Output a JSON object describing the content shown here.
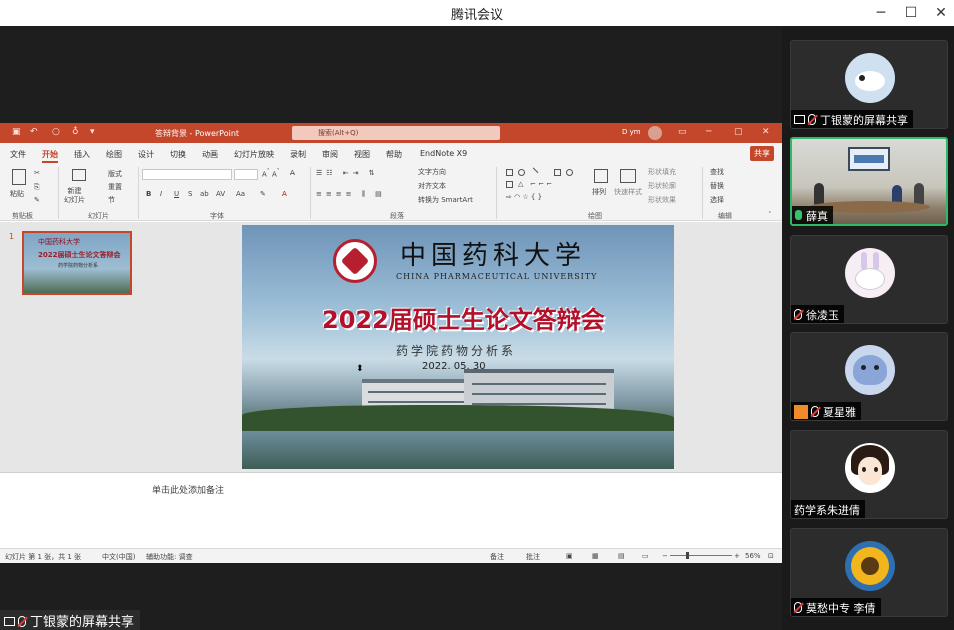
{
  "window": {
    "title": "腾讯会议",
    "minimize": "─",
    "maximize": "☐",
    "close": "✕"
  },
  "ppt": {
    "file_name": "答辩背景 - PowerPoint",
    "search_placeholder": "搜索(Alt+Q)",
    "user": "D ym",
    "tabs": [
      "文件",
      "开始",
      "插入",
      "绘图",
      "设计",
      "切换",
      "动画",
      "幻灯片放映",
      "录制",
      "审阅",
      "视图",
      "帮助",
      "EndNote X9"
    ],
    "active_tab": "开始",
    "share_button": "共享",
    "ribbon_groups": [
      "剪贴板",
      "幻灯片",
      "字体",
      "段落",
      "绘图",
      "编辑"
    ],
    "ribbon_tools": {
      "paste": "粘贴",
      "new_slide": "新建\n幻灯片",
      "layout": "版式",
      "reset": "重置",
      "section": "节",
      "text_direction": "文字方向",
      "align_text": "对齐文本",
      "smartart": "转换为 SmartArt",
      "arrange": "排列",
      "quick_styles": "快速样式",
      "shape_fill": "形状填充",
      "shape_outline": "形状轮廓",
      "shape_effects": "形状效果",
      "find": "查找",
      "replace": "替换",
      "select": "选择"
    },
    "thumbnail": {
      "number": "1",
      "line1": "中国药科大学",
      "line2": "2022届硕士生论文答辩会",
      "line3": "药学院药物分析系"
    },
    "slide": {
      "university_cn": "中国药科大学",
      "university_en": "CHINA PHARMACEUTICAL UNIVERSITY",
      "title": "2022届硕士生论文答辩会",
      "subtitle": "药学院药物分析系",
      "date": "2022. 05. 30"
    },
    "notes_placeholder": "单击此处添加备注",
    "status": {
      "slide_count": "幻灯片 第 1 张，共 1 张",
      "language": "中文(中国)",
      "accessibility": "辅助功能: 调查",
      "notes": "备注",
      "comments": "批注",
      "zoom": "56%"
    }
  },
  "share_label": "丁银蒙的屏幕共享",
  "participants": [
    {
      "name": "丁银蒙的屏幕共享",
      "avatar": "cat-icon",
      "screen": true,
      "active": false
    },
    {
      "name": "薛真",
      "avatar": "video",
      "screen": false,
      "active": true
    },
    {
      "name": "徐凌玉",
      "avatar": "rabbit-icon",
      "screen": false,
      "active": false
    },
    {
      "name": "夏星雅",
      "avatar": "ghost-icon",
      "screen": false,
      "active": false
    },
    {
      "name": "药学系朱进倩",
      "avatar": "cartoon-girl-icon",
      "screen": false,
      "active": false
    },
    {
      "name": "莫愁中专 李倩",
      "avatar": "sunflower-icon",
      "screen": false,
      "active": false
    }
  ],
  "colors": {
    "ppt_accent": "#c4472b",
    "active_speaker": "#2fb866",
    "slide_title": "#b4102a"
  }
}
